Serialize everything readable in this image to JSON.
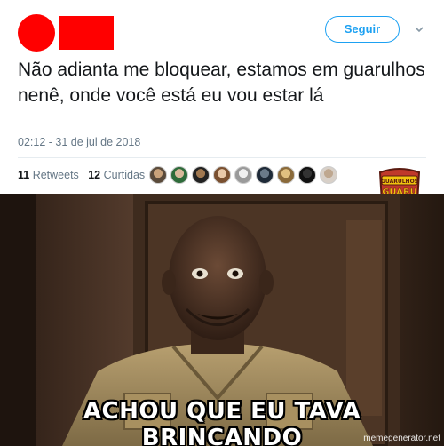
{
  "tweet": {
    "follow_label": "Seguir",
    "text": "Não adianta me bloquear, estamos em guarulhos nenê, onde você está eu vou estar lá",
    "timestamp": "02:12 - 31 de jul de 2018",
    "retweets_count": "11",
    "retweets_label": "Retweets",
    "likes_count": "12",
    "likes_label": "Curtidas",
    "accent_color": "#1da1f2",
    "redaction_color": "#ff0000"
  },
  "badge": {
    "lines": [
      "GUARULHOS",
      "GUARU",
      "TROLLS"
    ]
  },
  "meme": {
    "caption": "ACHOU QUE EU TAVA BRINCANDO",
    "watermark": "memegenerator.net"
  }
}
